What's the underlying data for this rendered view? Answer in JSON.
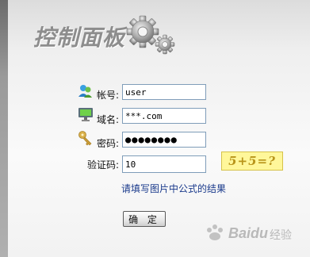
{
  "panel": {
    "title": "控制面板"
  },
  "form": {
    "account_label": "帐号:",
    "account_value": "user",
    "domain_label": "域名:",
    "domain_value": "***.com",
    "password_label": "密码:",
    "password_value": "●●●●●●●●",
    "captcha_label": "验证码:",
    "captcha_value": "10",
    "captcha_image_text": "5+5=?",
    "hint": "请填写图片中公式的结果",
    "submit_label": "确 定"
  },
  "watermark": {
    "brand": "Baidu",
    "text": "经验"
  },
  "icons": {
    "account": "user-icon",
    "domain": "monitor-icon",
    "password": "key-icon",
    "header": "gears-icon"
  }
}
